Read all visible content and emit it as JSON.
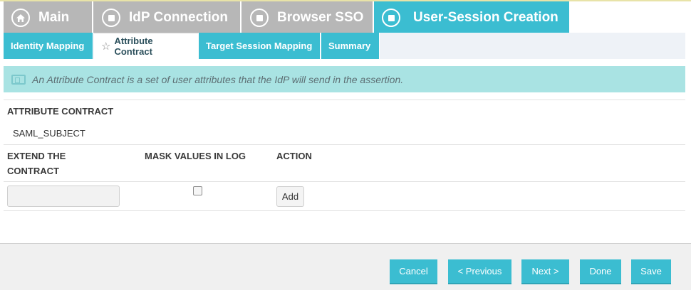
{
  "main_tabs": [
    {
      "label": "Main",
      "icon": "home-icon"
    },
    {
      "label": "IdP Connection",
      "icon": "square-circle-icon"
    },
    {
      "label": "Browser SSO",
      "icon": "square-circle-icon"
    },
    {
      "label": "User-Session Creation",
      "icon": "square-circle-icon"
    }
  ],
  "sub_tabs": [
    {
      "label": "Identity Mapping"
    },
    {
      "label": "Attribute Contract",
      "icon": "star-icon",
      "active": true
    },
    {
      "label": "Target Session Mapping"
    },
    {
      "label": "Summary"
    }
  ],
  "info": {
    "icon": "info-panel-icon",
    "text": "An Attribute Contract is a set of user attributes that the IdP will send in the assertion."
  },
  "contract": {
    "header": "ATTRIBUTE CONTRACT",
    "value": "SAML_SUBJECT"
  },
  "extend": {
    "col_extend_line1": "EXTEND THE",
    "col_extend_line2": "CONTRACT",
    "col_mask": "MASK VALUES IN LOG",
    "col_action": "ACTION",
    "input_value": "",
    "mask_checked": false,
    "add_label": "Add"
  },
  "footer": {
    "cancel": "Cancel",
    "previous": "< Previous",
    "next": "Next >",
    "done": "Done",
    "save": "Save"
  },
  "colors": {
    "accent": "#3bbdd1",
    "inactive_tab": "#b7b7b7",
    "info_bg": "#a9e3e3"
  }
}
